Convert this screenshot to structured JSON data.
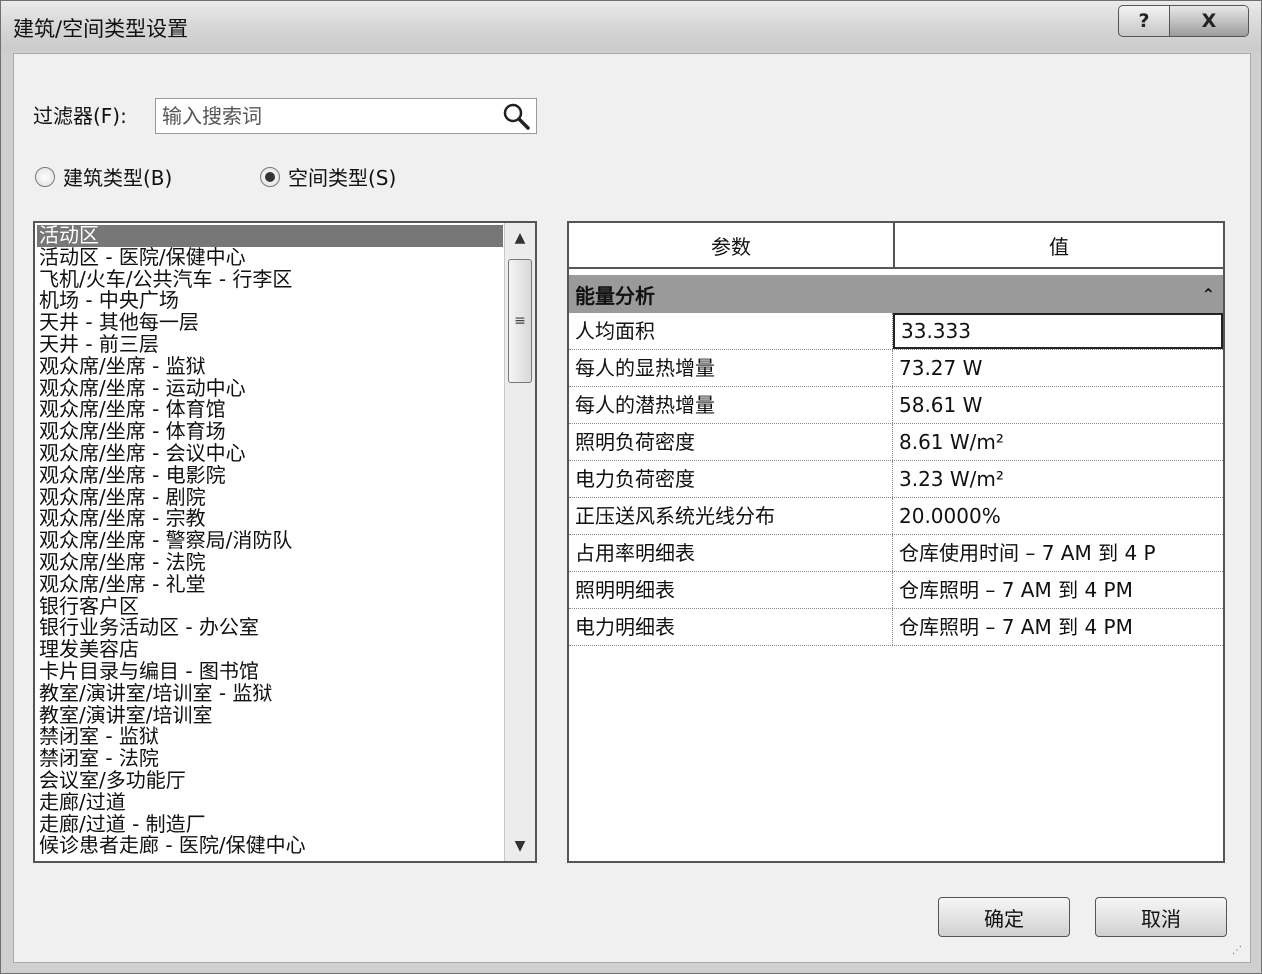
{
  "window": {
    "title": "建筑/空间类型设置",
    "help_label": "?",
    "close_label": "X"
  },
  "filter": {
    "label": "过滤器(F):",
    "placeholder": "输入搜索词"
  },
  "radios": {
    "building": {
      "label": "建筑类型(B)",
      "checked": false
    },
    "space": {
      "label": "空间类型(S)",
      "checked": true
    }
  },
  "list": {
    "items": [
      "活动区",
      "活动区 - 医院/保健中心",
      "飞机/火车/公共汽车 - 行李区",
      "机场 - 中央广场",
      "天井 - 其他每一层",
      "天井 - 前三层",
      "观众席/坐席 - 监狱",
      "观众席/坐席 - 运动中心",
      "观众席/坐席 - 体育馆",
      "观众席/坐席 - 体育场",
      "观众席/坐席 - 会议中心",
      "观众席/坐席 - 电影院",
      "观众席/坐席 - 剧院",
      "观众席/坐席 - 宗教",
      "观众席/坐席 - 警察局/消防队",
      "观众席/坐席 - 法院",
      "观众席/坐席 - 礼堂",
      "银行客户区",
      "银行业务活动区 - 办公室",
      "理发美容店",
      "卡片目录与编目 - 图书馆",
      "教室/演讲室/培训室 - 监狱",
      "教室/演讲室/培训室",
      "禁闭室 - 监狱",
      "禁闭室 - 法院",
      "会议室/多功能厅",
      "走廊/过道",
      "走廊/过道 - 制造厂",
      "候诊患者走廊 - 医院/保健中心"
    ],
    "selected_index": 0
  },
  "params": {
    "header_param": "参数",
    "header_value": "值",
    "group_title": "能量分析",
    "group_icon": "double-chevron-up",
    "rows": [
      {
        "name": "人均面积",
        "value": "33.333"
      },
      {
        "name": "每人的显热增量",
        "value": "73.27 W"
      },
      {
        "name": "每人的潜热增量",
        "value": "58.61 W"
      },
      {
        "name": "照明负荷密度",
        "value": "8.61 W/m²"
      },
      {
        "name": "电力负荷密度",
        "value": "3.23 W/m²"
      },
      {
        "name": "正压送风系统光线分布",
        "value": "20.0000%"
      },
      {
        "name": "占用率明细表",
        "value": "仓库使用时间 – 7 AM 到 4 P"
      },
      {
        "name": "照明明细表",
        "value": "仓库照明 – 7 AM 到 4 PM"
      },
      {
        "name": "电力明细表",
        "value": "仓库照明 – 7 AM 到 4 PM"
      }
    ]
  },
  "buttons": {
    "ok": "确定",
    "cancel": "取消"
  }
}
